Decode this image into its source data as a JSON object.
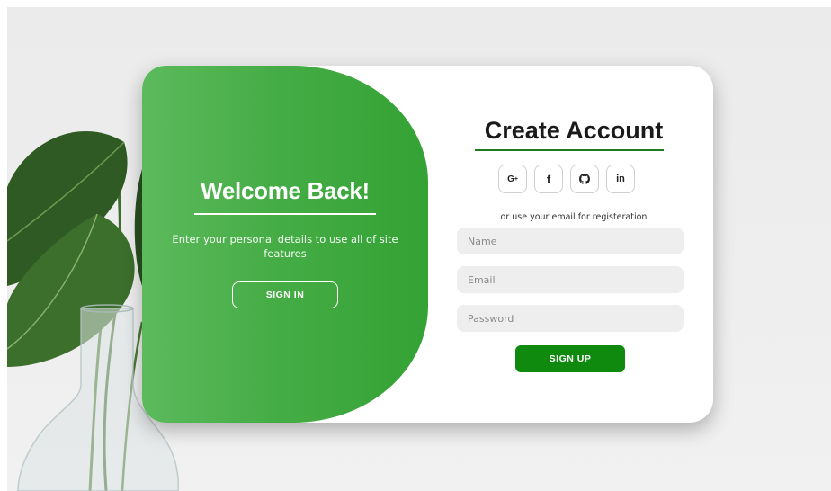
{
  "left_panel": {
    "title": "Welcome Back!",
    "text": "Enter your personal details to use all of site features",
    "signin_label": "SIGN IN"
  },
  "right_panel": {
    "title": "Create Account",
    "socials": [
      {
        "label": "G+",
        "icon": "google-plus-icon"
      },
      {
        "label": "f",
        "icon": "facebook-icon"
      },
      {
        "label": "github",
        "icon": "github-icon"
      },
      {
        "label": "in",
        "icon": "linkedin-icon"
      }
    ],
    "alt_text": "or use your email for registeration",
    "name_placeholder": "Name",
    "email_placeholder": "Email",
    "password_placeholder": "Password",
    "signup_label": "SIGN UP"
  },
  "colors": {
    "green_start": "#5cba5c",
    "green_end": "#34a234",
    "signup_green": "#0f8a0f",
    "underline_green": "#1f7a1f"
  }
}
